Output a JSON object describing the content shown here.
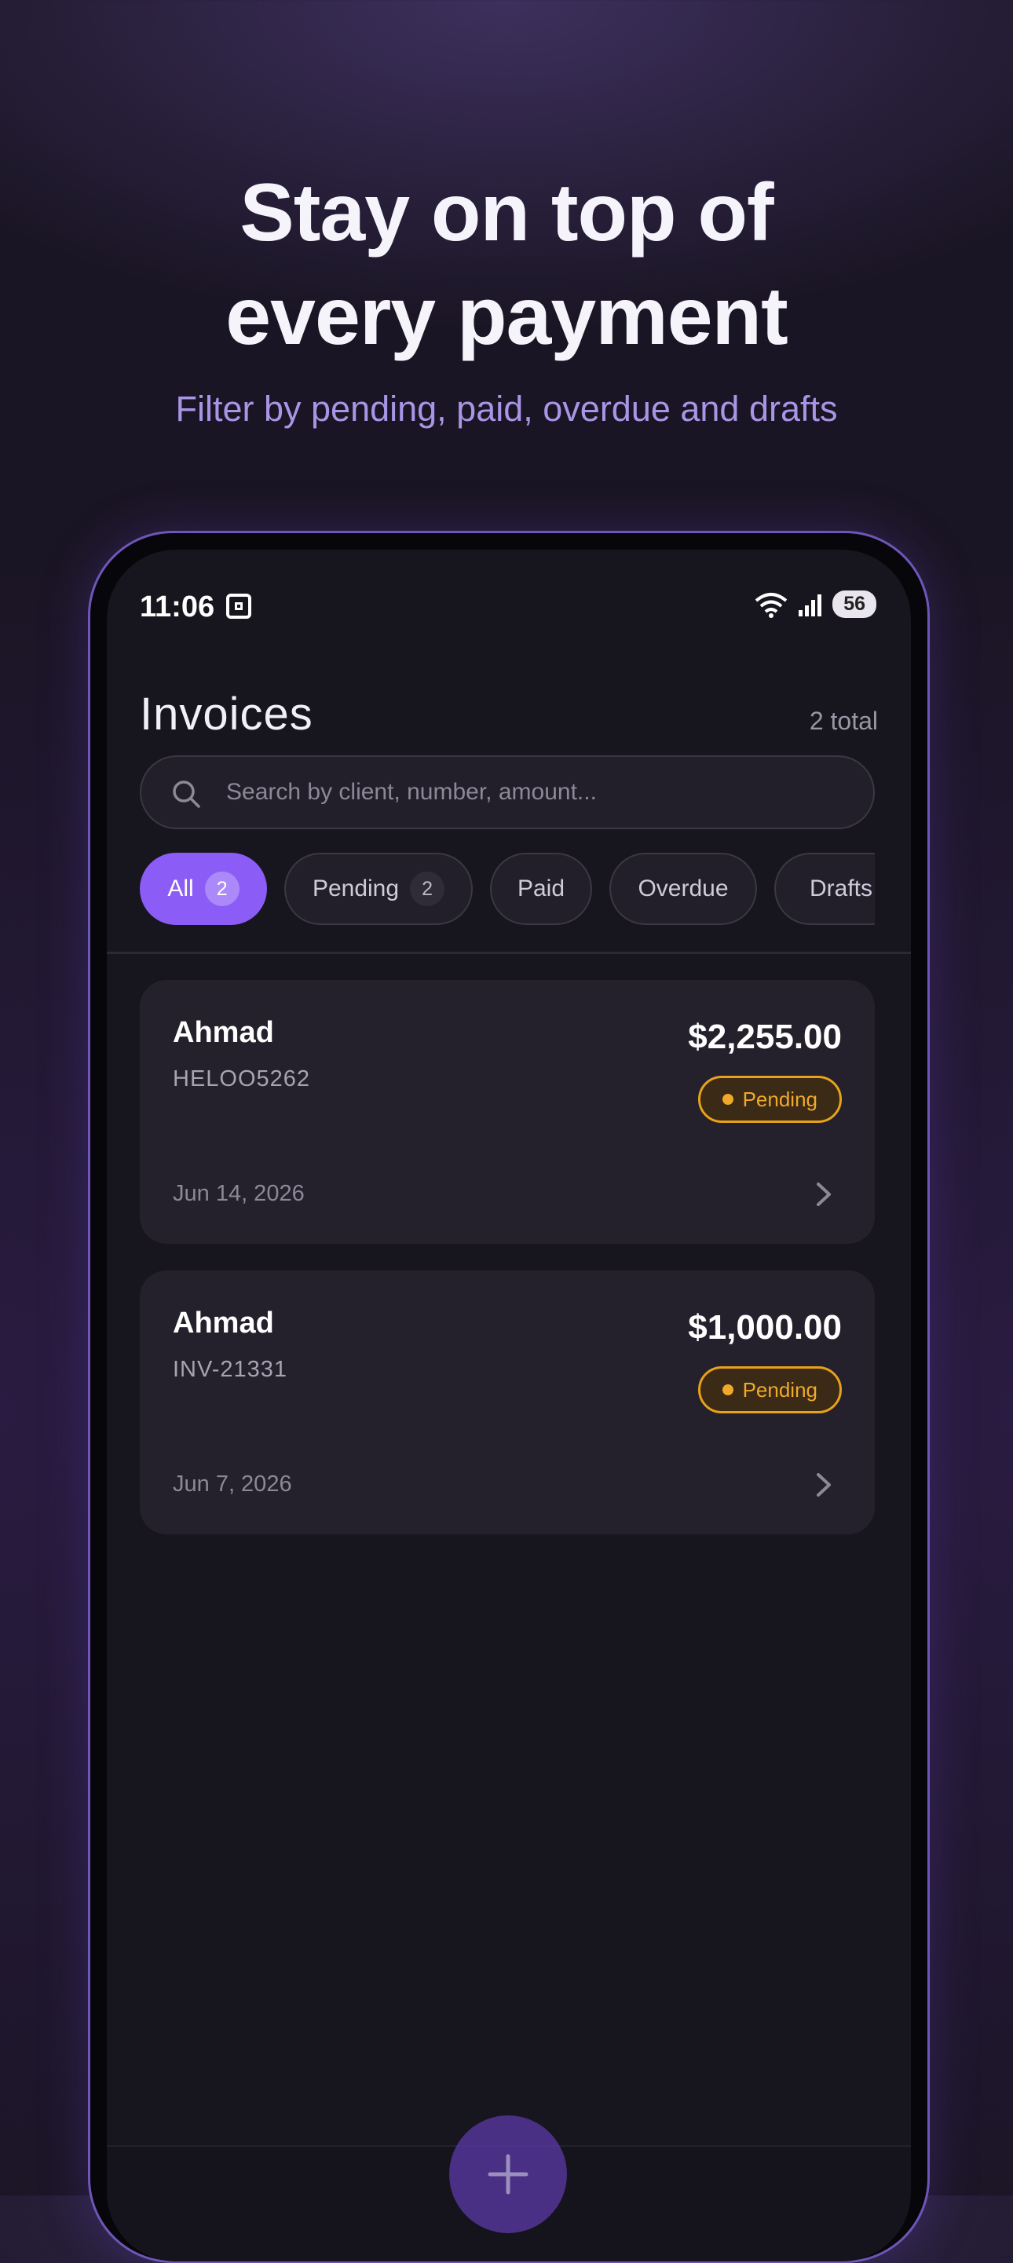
{
  "promo": {
    "headline_line1": "Stay on top of",
    "headline_line2": "every payment",
    "subheadline": "Filter by pending, paid, overdue and drafts"
  },
  "status_bar": {
    "time": "11:06",
    "battery": "56"
  },
  "header": {
    "title": "Invoices",
    "total": "2 total"
  },
  "search": {
    "placeholder": "Search by client, number, amount..."
  },
  "filters": [
    {
      "label": "All",
      "count": "2",
      "active": true
    },
    {
      "label": "Pending",
      "count": "2",
      "active": false
    },
    {
      "label": "Paid",
      "count": "",
      "active": false
    },
    {
      "label": "Overdue",
      "count": "",
      "active": false
    },
    {
      "label": "Drafts",
      "count": "",
      "active": false
    }
  ],
  "invoices": [
    {
      "client": "Ahmad",
      "number": "HELOO5262",
      "amount": "$2,255.00",
      "status": "Pending",
      "date": "Jun 14, 2026"
    },
    {
      "client": "Ahmad",
      "number": "INV-21331",
      "amount": "$1,000.00",
      "status": "Pending",
      "date": "Jun 7, 2026"
    }
  ],
  "colors": {
    "accent": "#8b5cf6",
    "pending": "#f0a92a",
    "background": "#17151d"
  }
}
